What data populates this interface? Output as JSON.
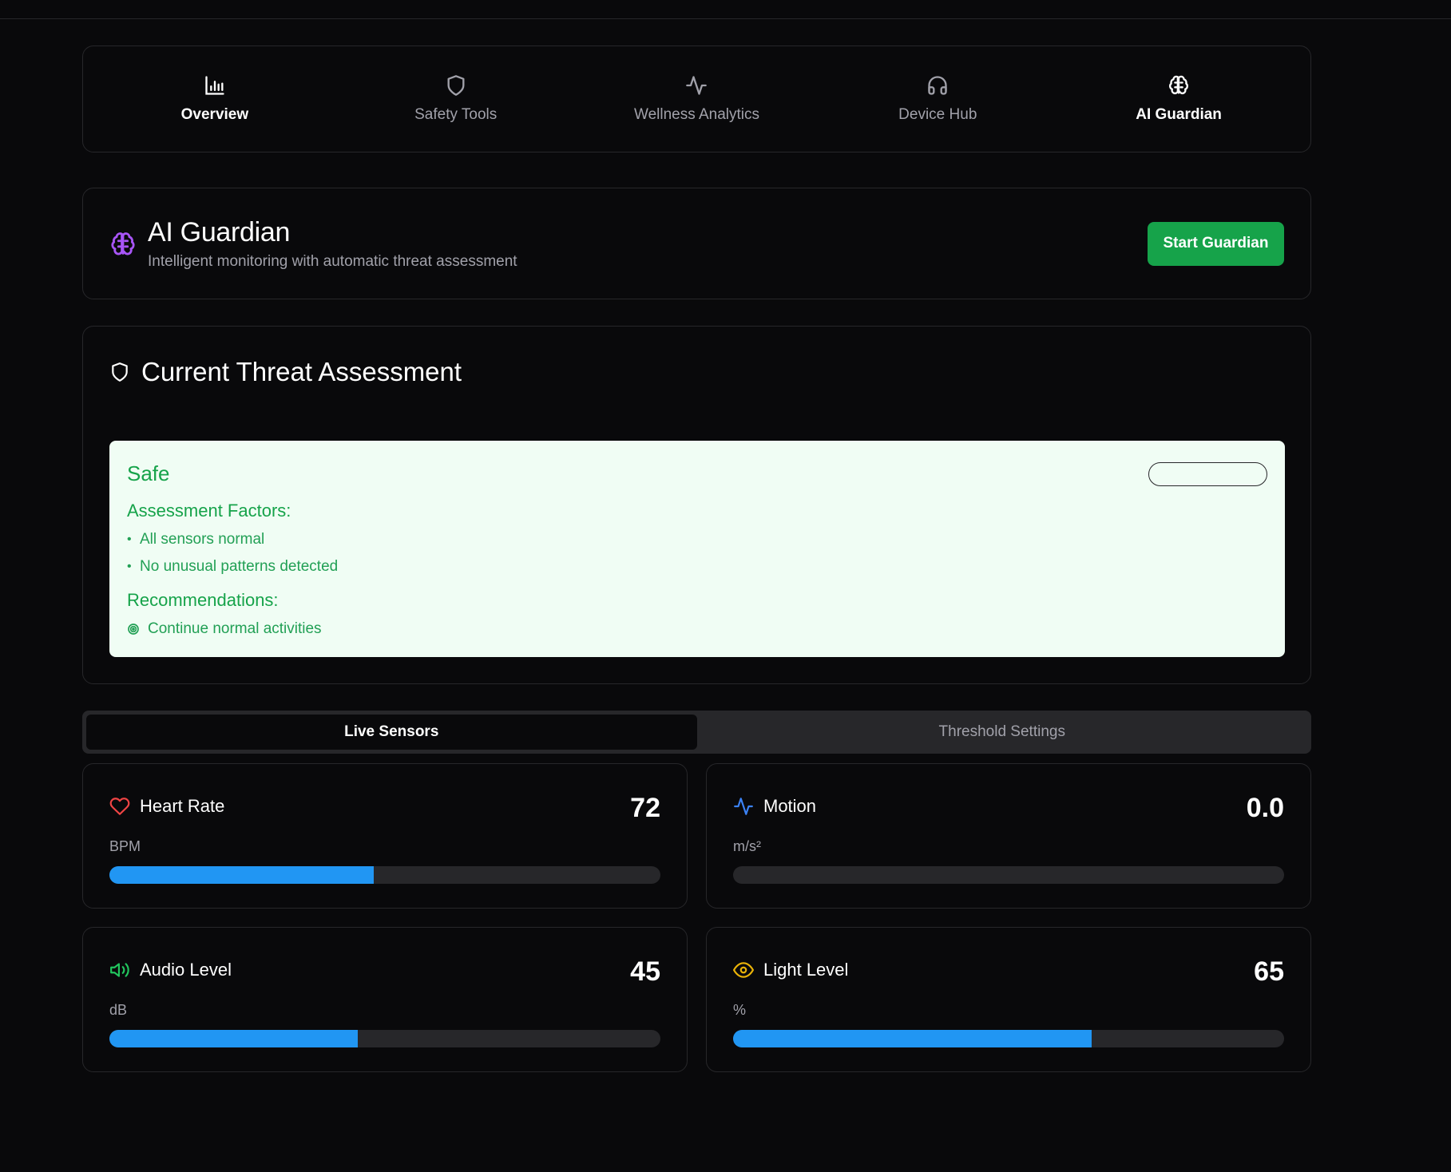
{
  "nav": {
    "items": [
      {
        "label": "Overview",
        "icon": "bar-chart-icon"
      },
      {
        "label": "Safety Tools",
        "icon": "shield-icon"
      },
      {
        "label": "Wellness Analytics",
        "icon": "activity-icon"
      },
      {
        "label": "Device Hub",
        "icon": "headphones-icon"
      },
      {
        "label": "AI Guardian",
        "icon": "brain-icon"
      }
    ],
    "active": "AI Guardian"
  },
  "header": {
    "title": "AI Guardian",
    "subtitle": "Intelligent monitoring with automatic threat assessment",
    "button": "Start Guardian",
    "accent_color": "#a855f7",
    "button_color": "#16a34a"
  },
  "threat": {
    "title": "Current Threat Assessment",
    "status": "Safe",
    "status_color": "#16a34a",
    "factors_title": "Assessment Factors:",
    "factors": [
      "All sensors normal",
      "No unusual patterns detected"
    ],
    "recommendations_title": "Recommendations:",
    "recommendations": [
      "Continue normal activities"
    ]
  },
  "tabs": {
    "items": [
      "Live Sensors",
      "Threshold Settings"
    ],
    "active": "Live Sensors"
  },
  "sensors": [
    {
      "label": "Heart Rate",
      "value": "72",
      "unit": "BPM",
      "level": 0.48,
      "icon": "heart-icon",
      "icon_color": "#ef4444"
    },
    {
      "label": "Motion",
      "value": "0.0",
      "unit": "m/s²",
      "level": 0.0,
      "icon": "activity-icon",
      "icon_color": "#3b82f6"
    },
    {
      "label": "Audio Level",
      "value": "45",
      "unit": "dB",
      "level": 0.45,
      "icon": "volume-icon",
      "icon_color": "#22c55e"
    },
    {
      "label": "Light Level",
      "value": "65",
      "unit": "%",
      "level": 0.65,
      "icon": "eye-icon",
      "icon_color": "#eab308"
    }
  ]
}
